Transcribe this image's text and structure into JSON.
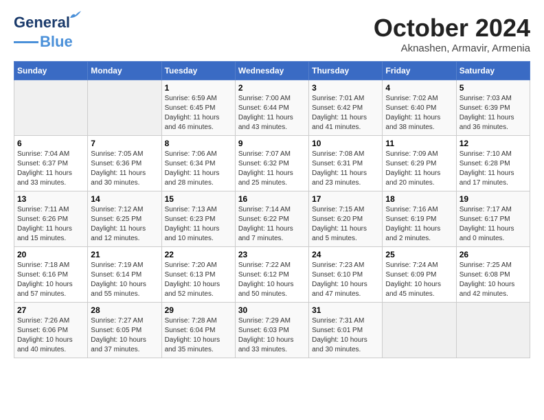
{
  "header": {
    "logo_line1": "General",
    "logo_line2": "Blue",
    "month": "October 2024",
    "location": "Aknashen, Armavir, Armenia"
  },
  "weekdays": [
    "Sunday",
    "Monday",
    "Tuesday",
    "Wednesday",
    "Thursday",
    "Friday",
    "Saturday"
  ],
  "weeks": [
    [
      {
        "day": "",
        "sunrise": "",
        "sunset": "",
        "daylight": ""
      },
      {
        "day": "",
        "sunrise": "",
        "sunset": "",
        "daylight": ""
      },
      {
        "day": "1",
        "sunrise": "Sunrise: 6:59 AM",
        "sunset": "Sunset: 6:45 PM",
        "daylight": "Daylight: 11 hours and 46 minutes."
      },
      {
        "day": "2",
        "sunrise": "Sunrise: 7:00 AM",
        "sunset": "Sunset: 6:44 PM",
        "daylight": "Daylight: 11 hours and 43 minutes."
      },
      {
        "day": "3",
        "sunrise": "Sunrise: 7:01 AM",
        "sunset": "Sunset: 6:42 PM",
        "daylight": "Daylight: 11 hours and 41 minutes."
      },
      {
        "day": "4",
        "sunrise": "Sunrise: 7:02 AM",
        "sunset": "Sunset: 6:40 PM",
        "daylight": "Daylight: 11 hours and 38 minutes."
      },
      {
        "day": "5",
        "sunrise": "Sunrise: 7:03 AM",
        "sunset": "Sunset: 6:39 PM",
        "daylight": "Daylight: 11 hours and 36 minutes."
      }
    ],
    [
      {
        "day": "6",
        "sunrise": "Sunrise: 7:04 AM",
        "sunset": "Sunset: 6:37 PM",
        "daylight": "Daylight: 11 hours and 33 minutes."
      },
      {
        "day": "7",
        "sunrise": "Sunrise: 7:05 AM",
        "sunset": "Sunset: 6:36 PM",
        "daylight": "Daylight: 11 hours and 30 minutes."
      },
      {
        "day": "8",
        "sunrise": "Sunrise: 7:06 AM",
        "sunset": "Sunset: 6:34 PM",
        "daylight": "Daylight: 11 hours and 28 minutes."
      },
      {
        "day": "9",
        "sunrise": "Sunrise: 7:07 AM",
        "sunset": "Sunset: 6:32 PM",
        "daylight": "Daylight: 11 hours and 25 minutes."
      },
      {
        "day": "10",
        "sunrise": "Sunrise: 7:08 AM",
        "sunset": "Sunset: 6:31 PM",
        "daylight": "Daylight: 11 hours and 23 minutes."
      },
      {
        "day": "11",
        "sunrise": "Sunrise: 7:09 AM",
        "sunset": "Sunset: 6:29 PM",
        "daylight": "Daylight: 11 hours and 20 minutes."
      },
      {
        "day": "12",
        "sunrise": "Sunrise: 7:10 AM",
        "sunset": "Sunset: 6:28 PM",
        "daylight": "Daylight: 11 hours and 17 minutes."
      }
    ],
    [
      {
        "day": "13",
        "sunrise": "Sunrise: 7:11 AM",
        "sunset": "Sunset: 6:26 PM",
        "daylight": "Daylight: 11 hours and 15 minutes."
      },
      {
        "day": "14",
        "sunrise": "Sunrise: 7:12 AM",
        "sunset": "Sunset: 6:25 PM",
        "daylight": "Daylight: 11 hours and 12 minutes."
      },
      {
        "day": "15",
        "sunrise": "Sunrise: 7:13 AM",
        "sunset": "Sunset: 6:23 PM",
        "daylight": "Daylight: 11 hours and 10 minutes."
      },
      {
        "day": "16",
        "sunrise": "Sunrise: 7:14 AM",
        "sunset": "Sunset: 6:22 PM",
        "daylight": "Daylight: 11 hours and 7 minutes."
      },
      {
        "day": "17",
        "sunrise": "Sunrise: 7:15 AM",
        "sunset": "Sunset: 6:20 PM",
        "daylight": "Daylight: 11 hours and 5 minutes."
      },
      {
        "day": "18",
        "sunrise": "Sunrise: 7:16 AM",
        "sunset": "Sunset: 6:19 PM",
        "daylight": "Daylight: 11 hours and 2 minutes."
      },
      {
        "day": "19",
        "sunrise": "Sunrise: 7:17 AM",
        "sunset": "Sunset: 6:17 PM",
        "daylight": "Daylight: 11 hours and 0 minutes."
      }
    ],
    [
      {
        "day": "20",
        "sunrise": "Sunrise: 7:18 AM",
        "sunset": "Sunset: 6:16 PM",
        "daylight": "Daylight: 10 hours and 57 minutes."
      },
      {
        "day": "21",
        "sunrise": "Sunrise: 7:19 AM",
        "sunset": "Sunset: 6:14 PM",
        "daylight": "Daylight: 10 hours and 55 minutes."
      },
      {
        "day": "22",
        "sunrise": "Sunrise: 7:20 AM",
        "sunset": "Sunset: 6:13 PM",
        "daylight": "Daylight: 10 hours and 52 minutes."
      },
      {
        "day": "23",
        "sunrise": "Sunrise: 7:22 AM",
        "sunset": "Sunset: 6:12 PM",
        "daylight": "Daylight: 10 hours and 50 minutes."
      },
      {
        "day": "24",
        "sunrise": "Sunrise: 7:23 AM",
        "sunset": "Sunset: 6:10 PM",
        "daylight": "Daylight: 10 hours and 47 minutes."
      },
      {
        "day": "25",
        "sunrise": "Sunrise: 7:24 AM",
        "sunset": "Sunset: 6:09 PM",
        "daylight": "Daylight: 10 hours and 45 minutes."
      },
      {
        "day": "26",
        "sunrise": "Sunrise: 7:25 AM",
        "sunset": "Sunset: 6:08 PM",
        "daylight": "Daylight: 10 hours and 42 minutes."
      }
    ],
    [
      {
        "day": "27",
        "sunrise": "Sunrise: 7:26 AM",
        "sunset": "Sunset: 6:06 PM",
        "daylight": "Daylight: 10 hours and 40 minutes."
      },
      {
        "day": "28",
        "sunrise": "Sunrise: 7:27 AM",
        "sunset": "Sunset: 6:05 PM",
        "daylight": "Daylight: 10 hours and 37 minutes."
      },
      {
        "day": "29",
        "sunrise": "Sunrise: 7:28 AM",
        "sunset": "Sunset: 6:04 PM",
        "daylight": "Daylight: 10 hours and 35 minutes."
      },
      {
        "day": "30",
        "sunrise": "Sunrise: 7:29 AM",
        "sunset": "Sunset: 6:03 PM",
        "daylight": "Daylight: 10 hours and 33 minutes."
      },
      {
        "day": "31",
        "sunrise": "Sunrise: 7:31 AM",
        "sunset": "Sunset: 6:01 PM",
        "daylight": "Daylight: 10 hours and 30 minutes."
      },
      {
        "day": "",
        "sunrise": "",
        "sunset": "",
        "daylight": ""
      },
      {
        "day": "",
        "sunrise": "",
        "sunset": "",
        "daylight": ""
      }
    ]
  ]
}
